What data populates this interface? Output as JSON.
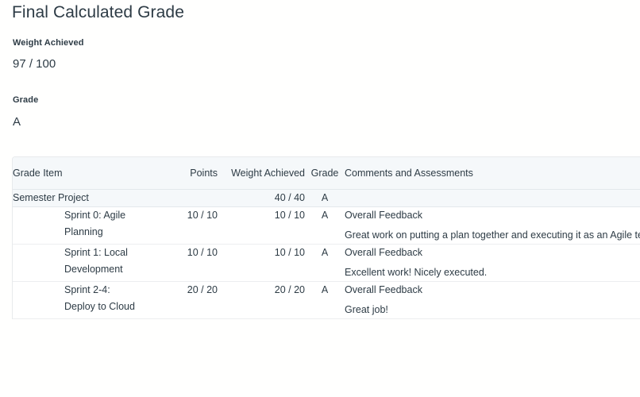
{
  "header": {
    "title": "Final Calculated Grade"
  },
  "summary": {
    "weight_label": "Weight Achieved",
    "weight_value": "97 / 100",
    "grade_label": "Grade",
    "grade_value": "A"
  },
  "table": {
    "columns": [
      "Grade Item",
      "Points",
      "Weight Achieved",
      "Grade",
      "Comments and Assessments"
    ],
    "rows": [
      {
        "type": "group",
        "name": "Semester Project",
        "points": "",
        "weight": "40 / 40",
        "grade": "A",
        "comment_title": "",
        "comment_body": ""
      },
      {
        "type": "item",
        "name": "Sprint 0: Agile Planning",
        "points": "10 / 10",
        "weight": "10 / 10",
        "grade": "A",
        "comment_title": "Overall Feedback",
        "comment_body": "Great work on putting a plan together and executing it as an Agile team!"
      },
      {
        "type": "item",
        "name": "Sprint 1: Local Development",
        "points": "10 / 10",
        "weight": "10 / 10",
        "grade": "A",
        "comment_title": "Overall Feedback",
        "comment_body": "Excellent work! Nicely executed."
      },
      {
        "type": "item",
        "name": "Sprint 2-4: Deploy to Cloud",
        "points": "20 / 20",
        "weight": "20 / 20",
        "grade": "A",
        "comment_title": "Overall Feedback",
        "comment_body": "Great job!"
      }
    ]
  },
  "colors": {
    "text": "#2d3b45",
    "row_group_bg": "#f5f8fa",
    "row_item_bg": "#ffffff",
    "border": "#e3e8ec",
    "page_bg": "#fffffe"
  }
}
